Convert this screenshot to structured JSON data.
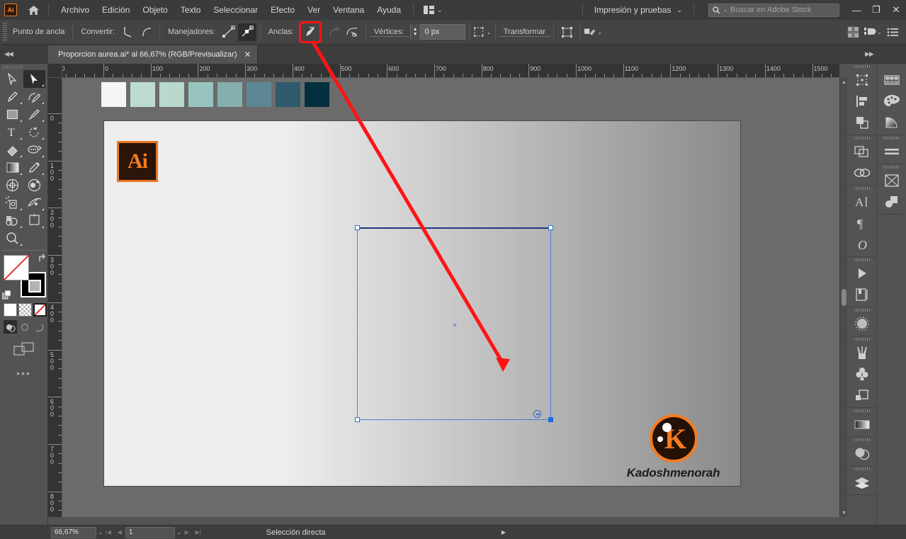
{
  "app": {
    "name": "Adobe Illustrator",
    "logo_text": "Ai",
    "accent_orange": "#e87722",
    "ui_bg": "#535353",
    "annotation_color": "#ff1414"
  },
  "menubar": {
    "items": [
      "Archivo",
      "Edición",
      "Objeto",
      "Texto",
      "Seleccionar",
      "Efecto",
      "Ver",
      "Ventana",
      "Ayuda"
    ],
    "home_icon": "home-icon",
    "arrange_icon": "arrange-documents-icon",
    "arrange_caret": "⌄",
    "workspace_label": "Impresión y pruebas",
    "workspace_caret": "⌄",
    "search_placeholder": "Buscar en Adobe Stock",
    "search_value": "",
    "search_icon": "search-icon",
    "window_minimize": "—",
    "window_restore": "❐",
    "window_close": "✕"
  },
  "optionsbar": {
    "context_label": "Punto de ancla",
    "convert_label": "Convertir:",
    "convert_corner_icon": "convert-to-corner-icon",
    "convert_smooth_icon": "convert-to-smooth-icon",
    "handles_label": "Manejadores:",
    "handles_show_icon": "show-handles-icon",
    "handles_hide_icon": "hide-handles-icon",
    "anchors_label": "Anclas:",
    "anchors_remove_icon": "remove-anchor-point-icon",
    "anchors_highlighted": true,
    "isolate_icon": "isolate-selected-path-icon",
    "cut_path_icon": "cut-path-at-anchor-icon",
    "corners_label": "Vértices:",
    "corners_value": "0 px",
    "stepper_up": "▲",
    "stepper_down": "▼",
    "align_icon": "align-to-selection-icon",
    "align_caret": "⌄",
    "transform_label": "Transformar",
    "reshape_icon": "reshape-icon",
    "style_icon": "graphic-style-icon",
    "style_caret": "⌄",
    "right_align_icon": "align-grid-icon",
    "right_arrange_icon": "arrange-objects-icon",
    "right_arrange_caret": "⌄",
    "right_menu_icon": "panel-menu-icon"
  },
  "tabbar": {
    "collapse_left_icon": "collapse-left-icon",
    "collapse_right_icon": "collapse-right-icon",
    "document_title": "Proporcion aurea.ai* al 66,67% (RGB/Previsualizar)",
    "close_icon": "✕"
  },
  "toolbar": {
    "tools": [
      {
        "name": "selection-tool",
        "selected": false,
        "submenu": false
      },
      {
        "name": "direct-selection-tool",
        "selected": true,
        "submenu": true
      },
      {
        "name": "pen-tool",
        "selected": false,
        "submenu": true
      },
      {
        "name": "curvature-tool",
        "selected": false,
        "submenu": true
      },
      {
        "name": "rectangle-tool",
        "selected": false,
        "submenu": true
      },
      {
        "name": "paintbrush-tool",
        "selected": false,
        "submenu": true
      },
      {
        "name": "type-tool",
        "selected": false,
        "submenu": true
      },
      {
        "name": "rotate-tool",
        "selected": false,
        "submenu": true
      },
      {
        "name": "eraser-tool",
        "selected": false,
        "submenu": true
      },
      {
        "name": "width-tool",
        "selected": false,
        "submenu": true
      },
      {
        "name": "gradient-tool",
        "selected": false,
        "submenu": true
      },
      {
        "name": "eyedropper-tool",
        "selected": false,
        "submenu": true
      },
      {
        "name": "mesh-tool",
        "selected": false,
        "submenu": false
      },
      {
        "name": "blend-tool",
        "selected": false,
        "submenu": false
      },
      {
        "name": "symbol-sprayer-tool",
        "selected": false,
        "submenu": true
      },
      {
        "name": "perspective-grid-tool",
        "selected": false,
        "submenu": true
      },
      {
        "name": "shape-builder-tool",
        "selected": false,
        "submenu": true
      },
      {
        "name": "artboard-tool",
        "selected": false,
        "submenu": true
      },
      {
        "name": "zoom-tool",
        "selected": false,
        "submenu": true
      }
    ],
    "fill_label": "fill-none-swatch",
    "stroke_label": "stroke-black-swatch",
    "swap_icon": "swap-fill-stroke-icon",
    "default_icon": "default-fill-stroke-icon",
    "color_mode_color": "color-swatch-button",
    "color_mode_gradient": "gradient-swatch-button",
    "color_mode_none": "none-swatch-button",
    "draw_normal": "draw-normal-button",
    "draw_behind": "draw-behind-button",
    "draw_inside": "draw-inside-button",
    "screen_mode": "change-screen-mode-button",
    "more_tools": "•••"
  },
  "rulers": {
    "unit": "px",
    "h_labels": [
      "00",
      "0",
      "100",
      "200",
      "300",
      "400",
      "500",
      "600",
      "700",
      "800",
      "900",
      "1000",
      "1100",
      "1200",
      "1300",
      "1400",
      "1500"
    ],
    "v_labels": [
      "0",
      "100",
      "200",
      "300",
      "400",
      "500",
      "600",
      "700",
      "800"
    ],
    "major_spacing_px": 66.7
  },
  "canvas": {
    "swatches": [
      "#f5f5f4",
      "#bedbd1",
      "#b7d8cb",
      "#97c5bd",
      "#85aeae",
      "#5e8795",
      "#2e5a6b",
      "#03303f"
    ],
    "artboard_gradient_from": "#eeeeee",
    "artboard_gradient_to": "#8a8a8a",
    "ai_logo_text": "Ai",
    "brand_name": "Kadoshmenorah",
    "brand_initial": "K",
    "selection": {
      "anchors_total": 4,
      "selected_anchor": "bottom-right",
      "center_point_visible": true,
      "cursor_icon": "remove-anchor-cursor-icon"
    },
    "annotation": {
      "type": "arrow",
      "color": "#ff1414",
      "from": "anchors-toolbar-button",
      "to": "bottom-right-anchor"
    }
  },
  "scrollbars": {
    "vertical_up": "▲",
    "vertical_down": "▼",
    "horizontal_left": "◀",
    "horizontal_right": "▶"
  },
  "statusbar": {
    "zoom_value": "66,67%",
    "zoom_caret": "⌄",
    "first_page_icon": "|◀",
    "prev_page_icon": "◀",
    "page_value": "1",
    "page_caret": "⌄",
    "next_page_icon": "▶",
    "last_page_icon": "▶|",
    "current_tool": "Selección directa",
    "status_next_icon": "▶",
    "status_prev_icon": "◀"
  },
  "rightpanels": {
    "column_one": [
      {
        "name": "transform-panel-icon",
        "group_start": false
      },
      {
        "name": "align-panel-icon",
        "group_start": false
      },
      {
        "name": "pathfinder-panel-icon",
        "group_start": false
      },
      {
        "name": "artboards-panel-icon",
        "group_start": true
      },
      {
        "name": "links-panel-icon",
        "group_start": false
      },
      {
        "name": "character-panel-icon",
        "group_start": true
      },
      {
        "name": "paragraph-panel-icon",
        "group_start": false
      },
      {
        "name": "glyphs-panel-icon",
        "group_start": false
      },
      {
        "name": "actions-panel-icon",
        "group_start": true
      },
      {
        "name": "pages-panel-icon",
        "group_start": false
      },
      {
        "name": "appearance-panel-icon",
        "group_start": true
      },
      {
        "name": "brushes-panel-icon",
        "group_start": true
      },
      {
        "name": "symbols-panel-icon",
        "group_start": false
      },
      {
        "name": "graphic-styles-panel-icon",
        "group_start": false
      },
      {
        "name": "gradient-panel-icon",
        "group_start": true
      },
      {
        "name": "transparency-panel-icon",
        "group_start": true
      },
      {
        "name": "layers-panel-icon",
        "group_start": true
      }
    ],
    "column_two": [
      {
        "name": "swatches-panel-icon",
        "group_start": false
      },
      {
        "name": "color-panel-icon",
        "group_start": false
      },
      {
        "name": "color-guide-panel-icon",
        "group_start": false
      },
      {
        "name": "stroke-panel-icon",
        "group_start": true
      },
      {
        "name": "separations-preview-panel-icon",
        "group_start": true
      },
      {
        "name": "asset-export-panel-icon",
        "group_start": false
      }
    ]
  }
}
